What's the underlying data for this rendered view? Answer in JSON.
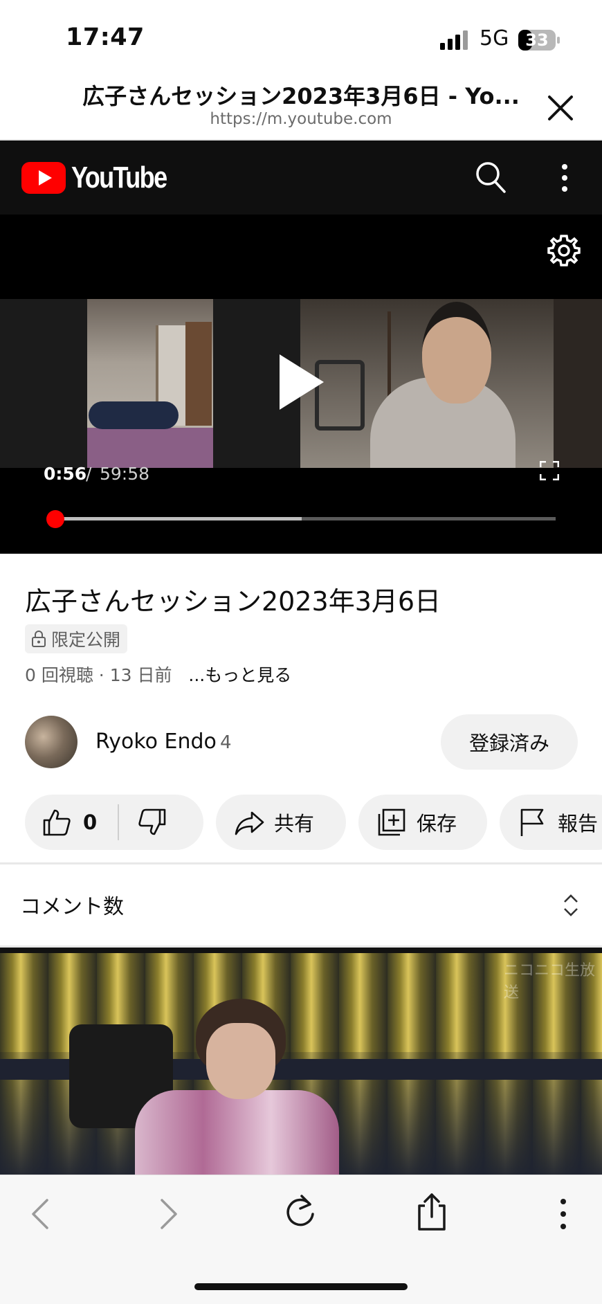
{
  "status_bar": {
    "time": "17:47",
    "network": "5G",
    "battery": "33",
    "icons": [
      "signal-bars-icon",
      "battery-icon"
    ]
  },
  "browser": {
    "page_title": "広子さんセッション2023年3月6日 - Yo...",
    "url": "https://m.youtube.com",
    "icons": [
      "close-icon",
      "back-icon",
      "forward-icon",
      "reload-icon",
      "share-icon",
      "more-vertical-icon"
    ]
  },
  "youtube_header": {
    "logo_text": "YouTube",
    "brand_color": "#ff0000",
    "icons": [
      "youtube-play-logo-icon",
      "search-icon",
      "more-vertical-icon"
    ]
  },
  "player": {
    "current_time": "0:56",
    "separator": "/",
    "duration": "59:58",
    "played_fraction": 0.016,
    "buffered_fraction": 0.5,
    "icons": [
      "gear-icon",
      "play-icon",
      "fullscreen-icon"
    ]
  },
  "video": {
    "title": "広子さんセッション2023年3月6日",
    "visibility_badge": "限定公開",
    "meta": "0 回視聴 · 13 日前",
    "more_link": "...もっと見る"
  },
  "channel": {
    "name": "Ryoko Endo",
    "subscriber_count": "4",
    "subscribe_label": "登録済み"
  },
  "actions": {
    "like_count": "0",
    "share_label": "共有",
    "save_label": "保存",
    "report_label": "報告",
    "icons": [
      "thumbs-up-icon",
      "thumbs-down-icon",
      "share-arrow-icon",
      "add-to-playlist-icon",
      "flag-icon"
    ]
  },
  "comments": {
    "label": "コメント数",
    "icons": [
      "expand-toggle-icon"
    ]
  }
}
